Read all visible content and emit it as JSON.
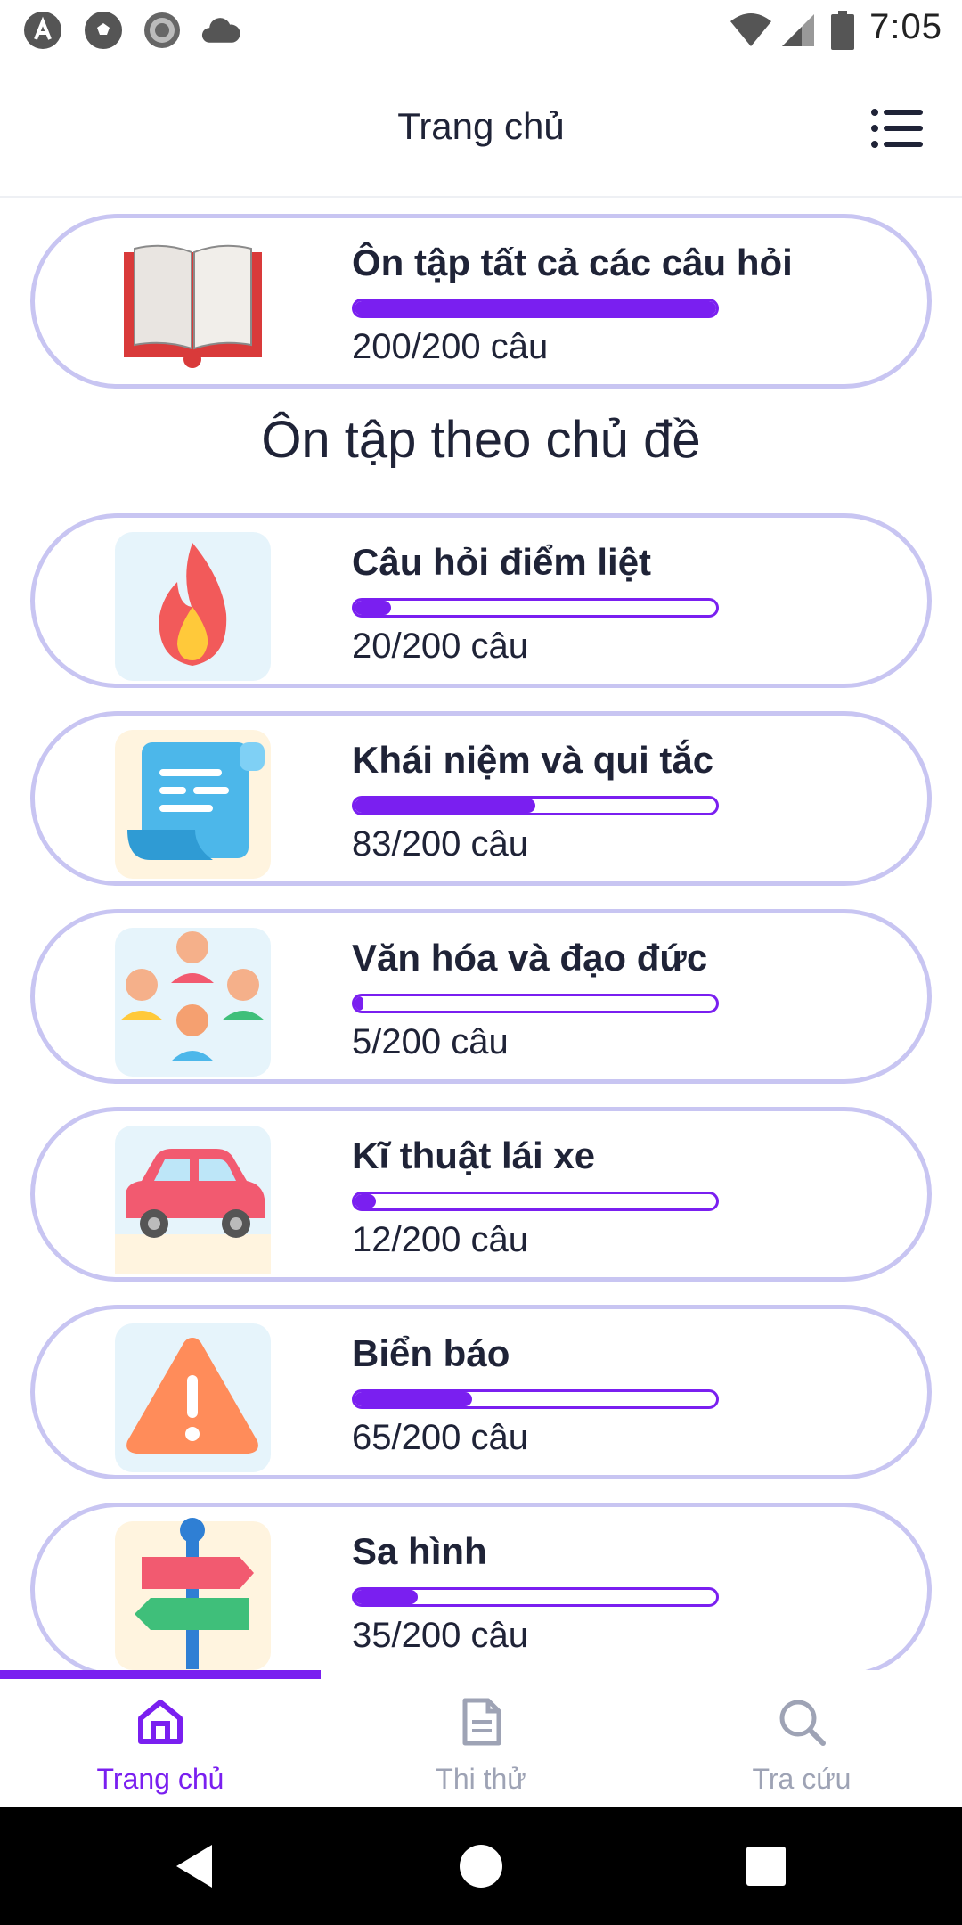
{
  "status_bar": {
    "time": "7:05",
    "left_icons": [
      "android-a-icon",
      "soccer-ball-icon",
      "record-icon",
      "cloud-icon"
    ],
    "right_icons": [
      "wifi-icon",
      "signal-icon",
      "battery-icon"
    ]
  },
  "app_bar": {
    "title": "Trang chủ",
    "menu_icon": "list-menu-icon"
  },
  "all_questions": {
    "title": "Ôn tập tất cả các câu hỏi",
    "count": "200/200 câu",
    "progress": 1.0,
    "icon": "open-book-icon"
  },
  "section_heading": "Ôn tập theo chủ đề",
  "topics": [
    {
      "title": "Câu hỏi điểm liệt",
      "count": "20/200 câu",
      "progress": 0.1,
      "icon": "fire-icon"
    },
    {
      "title": "Khái niệm và qui tắc",
      "count": "83/200 câu",
      "progress": 0.5,
      "icon": "scroll-icon"
    },
    {
      "title": "Văn hóa và đạo đức",
      "count": "5/200 câu",
      "progress": 0.025,
      "icon": "people-icon"
    },
    {
      "title": "Kĩ thuật lái xe",
      "count": "12/200 câu",
      "progress": 0.06,
      "icon": "car-icon"
    },
    {
      "title": "Biển báo",
      "count": "65/200 câu",
      "progress": 0.325,
      "icon": "warning-sign-icon"
    },
    {
      "title": "Sa hình",
      "count": "35/200 câu",
      "progress": 0.175,
      "icon": "signpost-icon"
    }
  ],
  "bottom_nav": {
    "items": [
      {
        "label": "Trang chủ",
        "icon": "home-icon",
        "active": true
      },
      {
        "label": "Thi thử",
        "icon": "document-icon",
        "active": false
      },
      {
        "label": "Tra cứu",
        "icon": "search-icon",
        "active": false
      }
    ]
  },
  "colors": {
    "accent": "#7a1ff0",
    "card_border": "#c8c5f2",
    "text": "#1f2337",
    "inactive": "#9ea3b5"
  }
}
